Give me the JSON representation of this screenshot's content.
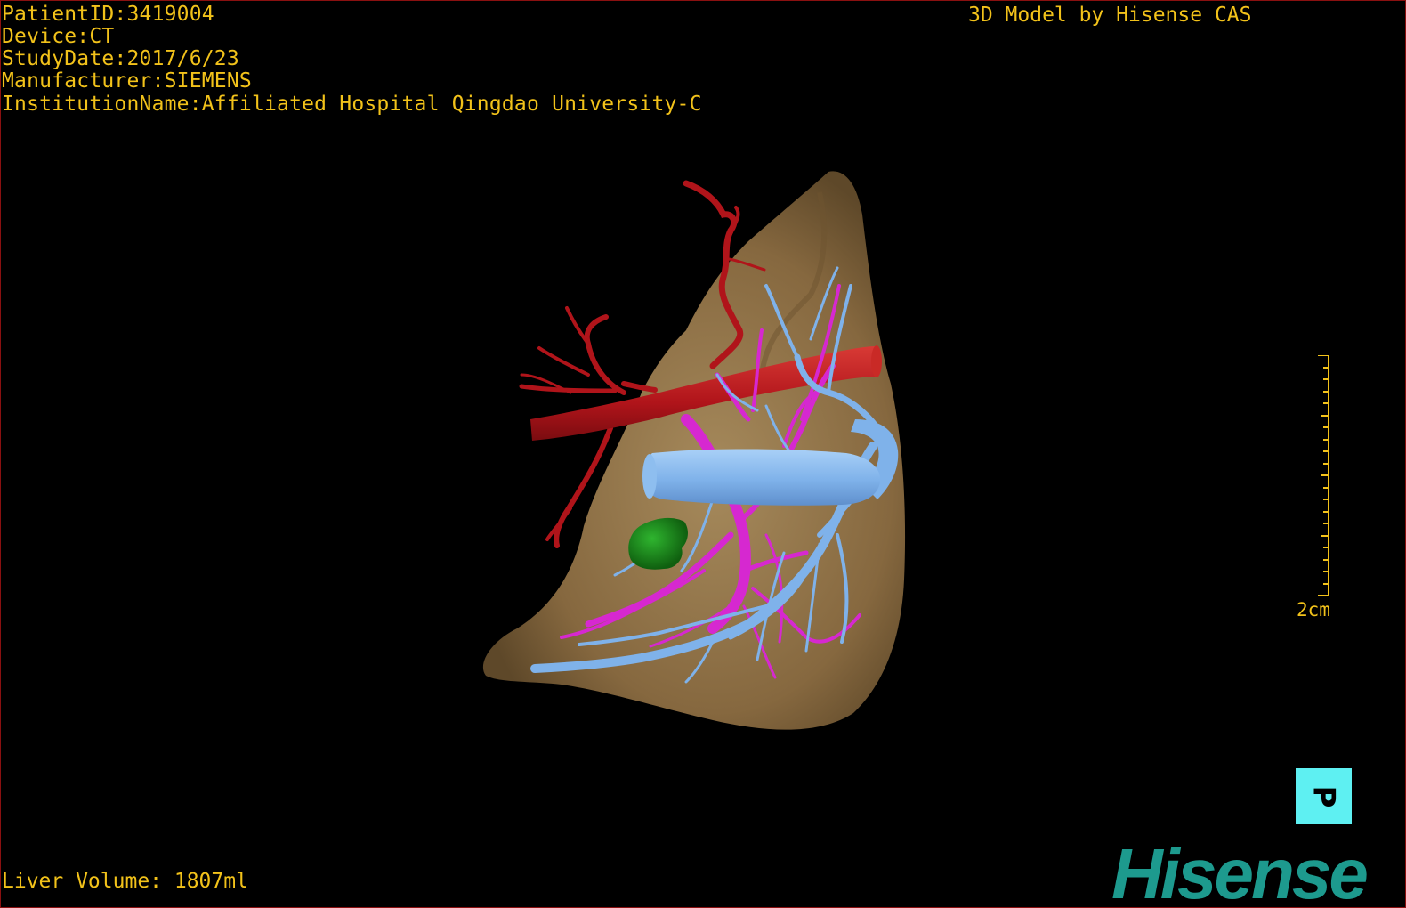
{
  "study_info": {
    "patient_id": "PatientID:3419004",
    "device": "Device:CT",
    "study_date": "StudyDate:2017/6/23",
    "manufacturer": "Manufacturer:SIEMENS",
    "institution": "InstitutionName:Affiliated Hospital Qingdao University-C"
  },
  "credit": "3D Model by Hisense CAS",
  "scale": {
    "label": "2cm"
  },
  "orientation": {
    "label": "P"
  },
  "liver_volume": "Liver Volume: 1807ml",
  "brand": "Hisense",
  "colors": {
    "text": "#f2c21a",
    "liver": "#8a7046",
    "artery": "#b0141a",
    "portal_vein": "#7fb2ea",
    "hepatic_vein": "#d628d0",
    "lesion": "#1b8a1b",
    "orientation_marker": "#5ef0f2",
    "brand": "#1d9a8e"
  }
}
